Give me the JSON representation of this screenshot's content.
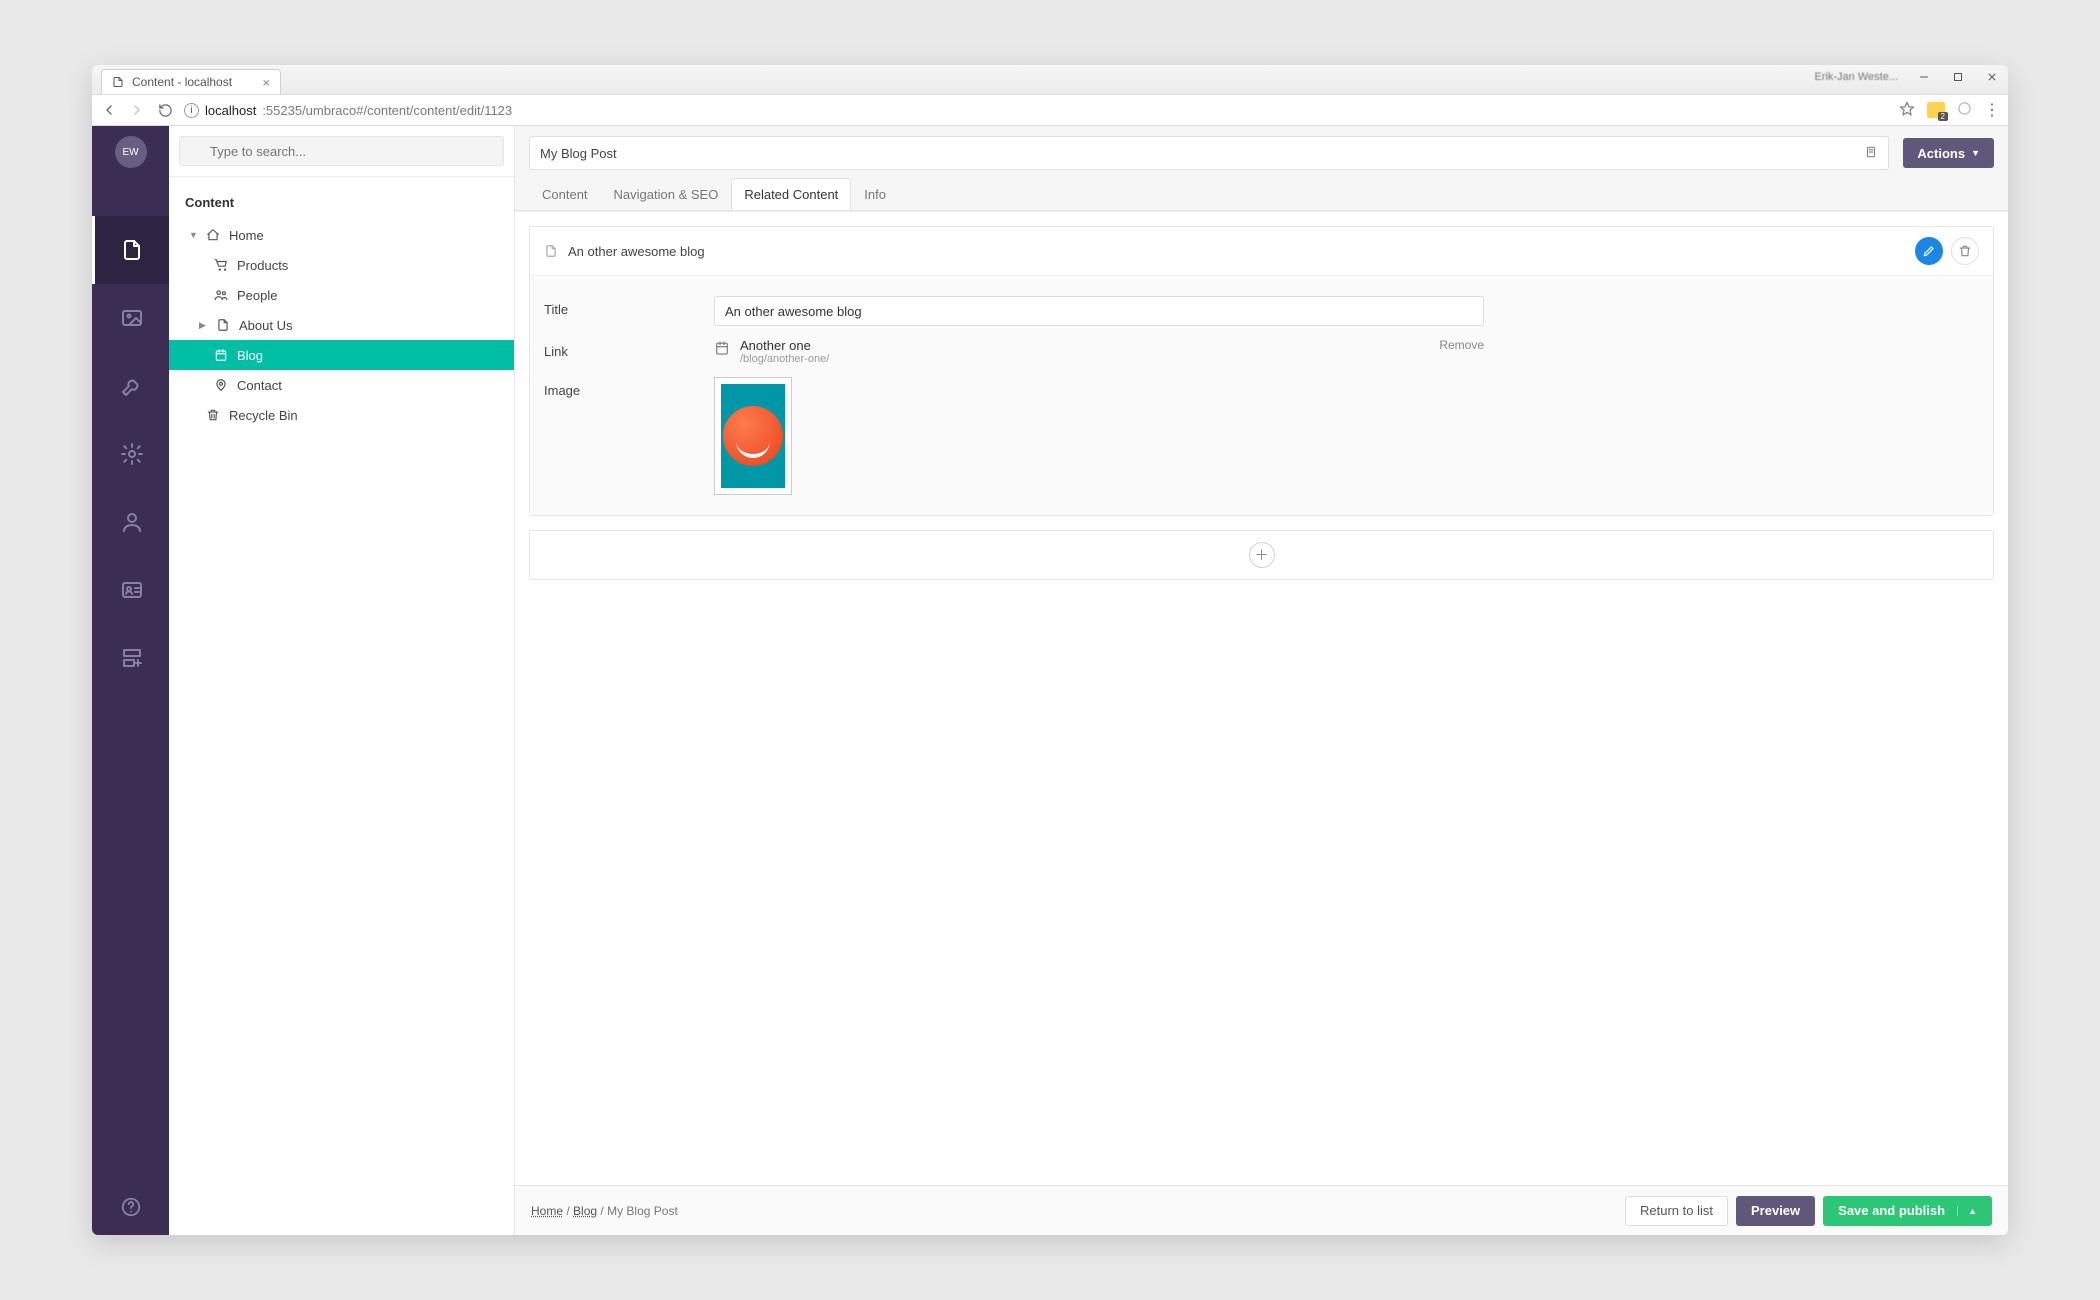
{
  "browser": {
    "tab_title": "Content - localhost",
    "profile_name": "Erik-Jan Weste...",
    "url_host": "localhost",
    "url_port_path": ":55235/umbraco#/content/content/edit/1123"
  },
  "rail": {
    "avatar_initials": "EW"
  },
  "tree": {
    "search_placeholder": "Type to search...",
    "section_label": "Content",
    "items": [
      {
        "label": "Home",
        "icon": "home",
        "expanded": true
      },
      {
        "label": "Products",
        "icon": "cart"
      },
      {
        "label": "People",
        "icon": "people"
      },
      {
        "label": "About Us",
        "icon": "doc",
        "expandable": true
      },
      {
        "label": "Blog",
        "icon": "calendar",
        "selected": true
      },
      {
        "label": "Contact",
        "icon": "pin"
      }
    ],
    "recycle_label": "Recycle Bin"
  },
  "editor": {
    "page_title": "My Blog Post",
    "actions_label": "Actions",
    "tabs": [
      "Content",
      "Navigation & SEO",
      "Related Content",
      "Info"
    ],
    "active_tab": 2,
    "block": {
      "heading": "An other awesome blog",
      "fields": {
        "title_label": "Title",
        "title_value": "An other awesome blog",
        "link_label": "Link",
        "link_title": "Another one",
        "link_path": "/blog/another-one/",
        "link_remove": "Remove",
        "image_label": "Image"
      }
    }
  },
  "footer": {
    "crumbs": [
      "Home",
      "Blog",
      "My Blog Post"
    ],
    "return_label": "Return to list",
    "preview_label": "Preview",
    "publish_label": "Save and publish"
  }
}
